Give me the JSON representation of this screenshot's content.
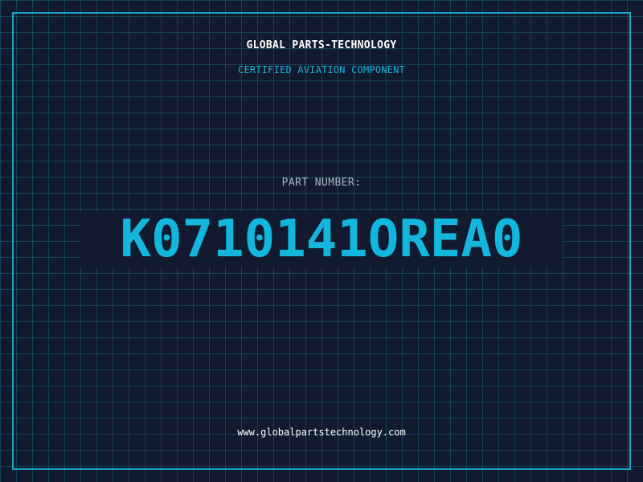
{
  "header": {
    "company": "GLOBAL PARTS-TECHNOLOGY",
    "tagline": "CERTIFIED AVIATION COMPONENT"
  },
  "part": {
    "label": "PART NUMBER:",
    "number": "K0710141OREA0"
  },
  "footer": {
    "website": "www.globalpartstechnology.com"
  },
  "colors": {
    "background": "#111a2e",
    "grid": "#1e5f7d",
    "frame": "#1aa6c8",
    "accent": "#13b6dc",
    "label": "#a9b3c2",
    "text": "#ffffff"
  }
}
